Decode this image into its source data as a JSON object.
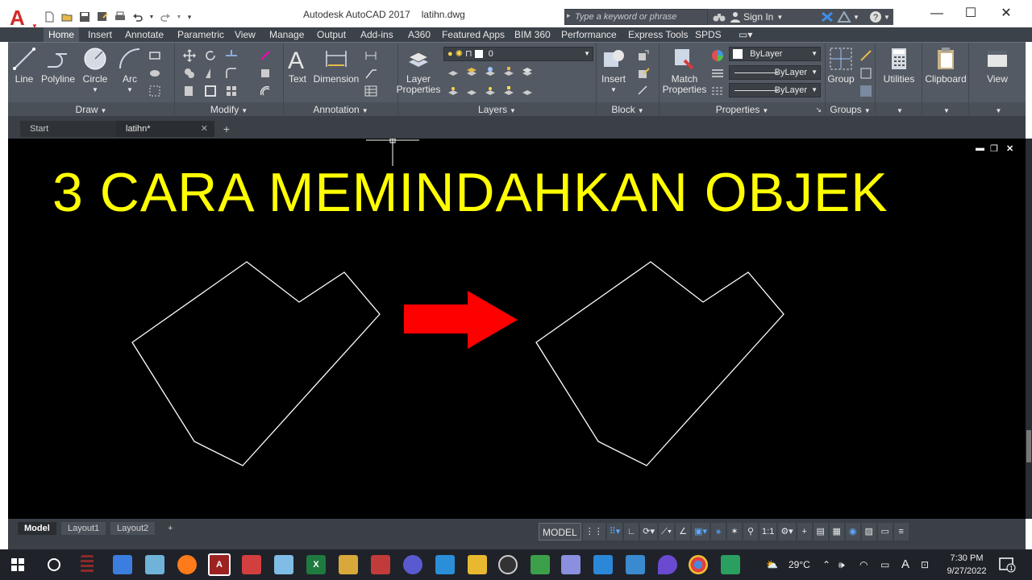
{
  "window": {
    "app_title": "Autodesk AutoCAD 2017",
    "file_name": "latihn.dwg",
    "search_placeholder": "Type a keyword or phrase",
    "sign_in": "Sign In"
  },
  "ribbon_tabs": [
    "Home",
    "Insert",
    "Annotate",
    "Parametric",
    "View",
    "Manage",
    "Output",
    "Add-ins",
    "A360",
    "Featured Apps",
    "BIM 360",
    "Performance",
    "Express Tools",
    "SPDS"
  ],
  "ribbon": {
    "draw": {
      "title": "Draw",
      "line": "Line",
      "polyline": "Polyline",
      "circle": "Circle",
      "arc": "Arc"
    },
    "modify": {
      "title": "Modify"
    },
    "annotation": {
      "title": "Annotation",
      "text": "Text",
      "dimension": "Dimension"
    },
    "layers": {
      "title": "Layers",
      "layer_properties_1": "Layer",
      "layer_properties_2": "Properties",
      "current_layer": "0"
    },
    "block": {
      "title": "Block",
      "insert": "Insert"
    },
    "properties": {
      "title": "Properties",
      "match_1": "Match",
      "match_2": "Properties",
      "color": "ByLayer",
      "linetype": "ByLayer",
      "lineweight": "ByLayer"
    },
    "groups": {
      "title": "Groups",
      "group": "Group"
    },
    "utilities": "Utilities",
    "clipboard": "Clipboard",
    "view": "View"
  },
  "file_tabs": {
    "start": "Start",
    "active": "latihn*"
  },
  "drawing": {
    "heading": "3 CARA MEMINDAHKAN OBJEK",
    "heading_color": "#ffff00",
    "arrow_color": "#ff0000"
  },
  "layout_tabs": [
    "Model",
    "Layout1",
    "Layout2"
  ],
  "status_bar": {
    "model": "MODEL",
    "scale": "1:1"
  },
  "taskbar": {
    "temperature": "29°C",
    "lang": "A",
    "time": "7:30 PM",
    "date": "9/27/2022",
    "notifications": "1"
  }
}
